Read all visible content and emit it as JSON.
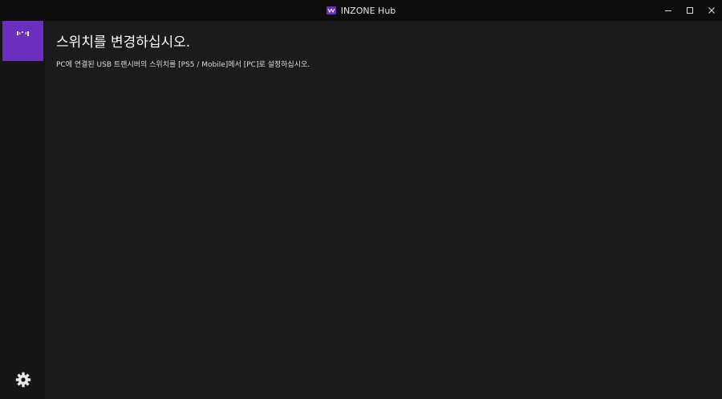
{
  "window": {
    "title": "INZONE Hub",
    "accent": "#6b2fc0",
    "controls": [
      "minimize-icon",
      "maximize-icon",
      "close-icon"
    ]
  },
  "sidebar": {
    "device_icon": "usb-transceiver-icon",
    "settings_icon": "gear-icon"
  },
  "main": {
    "heading": "스위치를 변경하십시오.",
    "description": "PC에 연결된 USB 트랜시버의 스위치를 [PS5 / Mobile]에서 [PC]로 설정하십시오."
  }
}
